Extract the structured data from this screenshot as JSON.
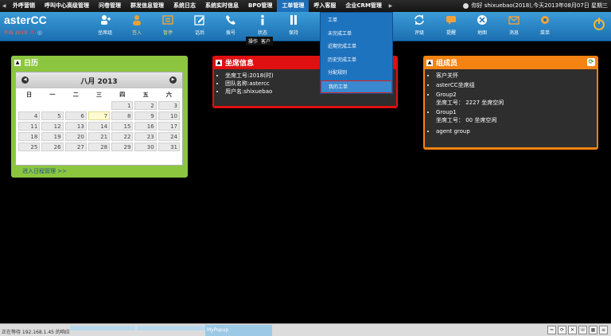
{
  "topmenu": {
    "items": [
      "外呼营销",
      "呼叫中心高级管理",
      "问卷管理",
      "群发信息管理",
      "系统日志",
      "系统实时信息",
      "BPO管理",
      "工单管理",
      "呼入客服",
      "企业CRM管理"
    ],
    "active_index": 7,
    "user_text": "你好 shixuebao(2018),今天2013年08月07日 星期三"
  },
  "toolbar": {
    "brand": "asterCC",
    "brand_sub": "外线 2018",
    "buttons": [
      "坐席组",
      "签入",
      "暂停",
      "话后",
      "拨号",
      "状态",
      "保持",
      "转接",
      "评级",
      "提醒",
      "地图",
      "消息",
      "菜单"
    ]
  },
  "tooltip": {
    "op": "操作",
    "cust": "客户"
  },
  "dropdown": {
    "items": [
      "工单",
      "未完成工单",
      "近期完成工单",
      "历史完成工单",
      "分配规则",
      "我的工单"
    ],
    "highlight_index": 5
  },
  "calendar_panel": {
    "title": "日历",
    "month_label": "八月 2013",
    "dow": [
      "日",
      "一",
      "二",
      "三",
      "四",
      "五",
      "六"
    ],
    "days": [
      "",
      "",
      "",
      "",
      "1",
      "2",
      "3",
      "4",
      "5",
      "6",
      "7",
      "8",
      "9",
      "10",
      "11",
      "12",
      "13",
      "14",
      "15",
      "16",
      "17",
      "18",
      "19",
      "20",
      "21",
      "22",
      "23",
      "24",
      "25",
      "26",
      "27",
      "28",
      "29",
      "30",
      "31"
    ],
    "today": "7",
    "link": "进入日程管理 >>"
  },
  "seat_panel": {
    "title": "坐席信息",
    "lines": [
      "坐席工号:2018(时)",
      "团队名称:astercc",
      "用户名:shixuebao"
    ]
  },
  "group_panel": {
    "title": "组成员",
    "items": [
      {
        "label": "客户关怀",
        "sub": ""
      },
      {
        "label": "asterCC坐席组",
        "sub": ""
      },
      {
        "label": "Group2",
        "sub": "坐席工号： 2227 坐席空闲"
      },
      {
        "label": "Group1",
        "sub": "坐席工号： 00 坐席空闲"
      },
      {
        "label": "agent group",
        "sub": ""
      }
    ]
  },
  "statusbar": {
    "status": "正在等待 192.168.1.45 的响应",
    "popup": "MyPopup"
  },
  "colors": {
    "calendar": "#8cc63f",
    "seat": "#e01010",
    "group": "#f48312",
    "toolbar": "#1b6fb0"
  }
}
